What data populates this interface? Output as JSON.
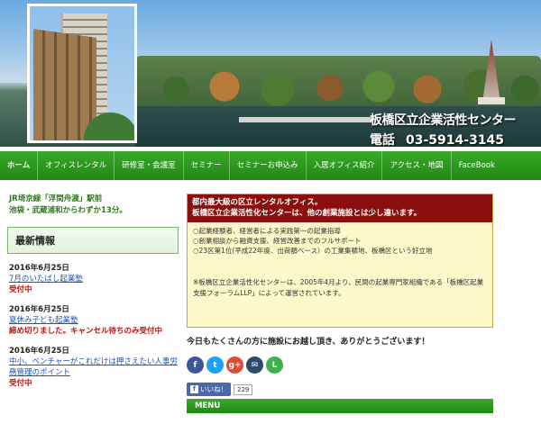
{
  "header": {
    "name": "板橋区立企業活性センター",
    "phone_label": "電話",
    "phone": "03-5914-3145"
  },
  "nav": {
    "items": [
      {
        "label": "ホーム",
        "active": true
      },
      {
        "label": "オフィスレンタル"
      },
      {
        "label": "研修室・会議室"
      },
      {
        "label": "セミナー"
      },
      {
        "label": "セミナーお申込み"
      },
      {
        "label": "入居オフィス紹介"
      },
      {
        "label": "アクセス・地図"
      },
      {
        "label": "FaceBook"
      }
    ]
  },
  "sidebar": {
    "access_lines": [
      "JR埼京線「浮間舟渡」駅前",
      "池袋・武蔵浦和からわずか13分。"
    ],
    "news_heading": "最新情報",
    "news": [
      {
        "date": "2016年6月25日",
        "title": "7月のいたばし起業塾",
        "status": "受付中"
      },
      {
        "date": "2016年6月25日",
        "title": "夏休み子ども起業塾",
        "status": "締め切りました。キャンセル待ちのみ受付中"
      },
      {
        "date": "2016年6月25日",
        "title": "中小、ベンチャーがこれだけは押さえたい人事労務管理のポイント",
        "status": "受付中"
      }
    ]
  },
  "main": {
    "notice_head": [
      "都内最大級の区立レンタルオフィス。",
      "板橋区立企業活性化センターは、他の創業施設とは少し違います。"
    ],
    "notice_points": [
      "○起業経験者、経営者による実践第一の起業指導",
      "○創業相談から融資支援、経営改善までのフルサポート",
      "○23区第1位(平成22年度、出荷額ベース）の工業集積地、板橋区という好立地"
    ],
    "notice_note": "※板橋区立企業活性化センターは、2005年4月より、民間の起業専門家組織である「板橋区起業支援フォーラムLLP」によって運営されています。",
    "thanks": "今日もたくさんの方に施設にお越し頂き、ありがとうございます！",
    "share_icons": [
      {
        "name": "facebook-share-icon",
        "glyph": "f",
        "color": "#3b5998"
      },
      {
        "name": "twitter-share-icon",
        "glyph": "t",
        "color": "#1da1f2"
      },
      {
        "name": "googleplus-share-icon",
        "glyph": "g+",
        "color": "#dd4b39"
      },
      {
        "name": "email-share-icon",
        "glyph": "✉",
        "color": "#2c4a6e"
      },
      {
        "name": "line-share-icon",
        "glyph": "L",
        "color": "#3cb34a"
      }
    ],
    "like_label": "いいね！",
    "like_count": "229",
    "menu_label": "MENU"
  }
}
